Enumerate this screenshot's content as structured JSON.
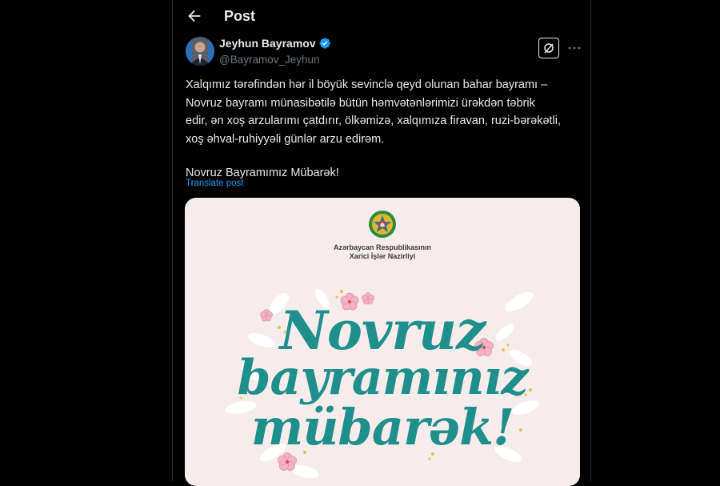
{
  "header": {
    "title": "Post"
  },
  "author": {
    "name": "Jeyhun Bayramov",
    "handle": "@Bayramov_Jeyhun"
  },
  "post": {
    "lines": [
      "Xalqımız tərəfindən hər il böyük sevinclə qeyd olunan bahar bayramı –",
      "Novruz bayramı münasibətilə bütün həmvətənlərimizi ürəkdən təbrik",
      "edir, ən xoş arzularımı çatdırır, ölkəmizə, xalqımıza firavan, ruzi-bərəkətli,",
      "xoş əhval-ruhiyyəli günlər arzu edirəm."
    ],
    "closing": "Novruz Bayramımız Mübarək!",
    "translate_label": "Translate post"
  },
  "media": {
    "ministry_line1": "Azərbaycan Respublikasının",
    "ministry_line2": "Xarici İşlər Nazirliyi",
    "headline_line1": "Novruz",
    "headline_line2": "bayramınız",
    "headline_line3": "mübarək!"
  },
  "colors": {
    "accent": "#1d9bf0",
    "headline": "#1f8f8b",
    "card_bg": "#f7ecec"
  },
  "icons": {
    "back": "arrow-left-icon",
    "verified": "verified-badge-icon",
    "grok": "grok-icon",
    "more": "more-icon"
  }
}
